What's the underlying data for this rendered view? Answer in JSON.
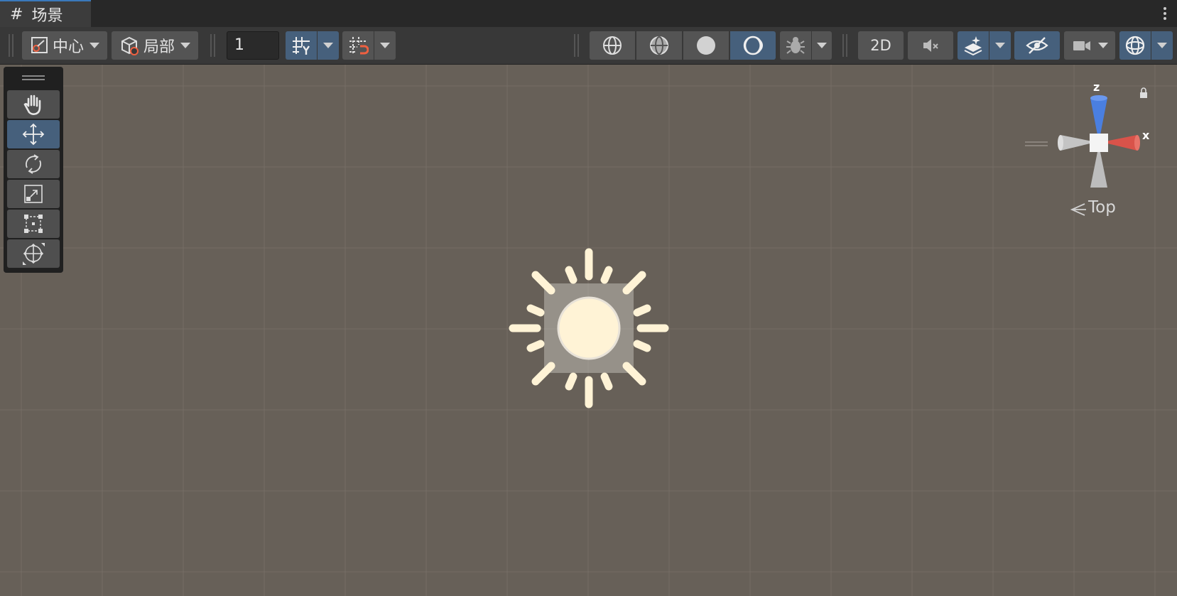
{
  "window": {
    "tab_label": "场景",
    "tab_icon": "scene-hash-icon"
  },
  "toolbar": {
    "pivot_label": "中心",
    "space_label": "局部",
    "grid_increment": "1",
    "toggle_2d_label": "2D"
  },
  "tools": [
    "hand-tool-icon",
    "move-tool-icon",
    "rotate-tool-icon",
    "scale-tool-icon",
    "rect-tool-icon",
    "transform-tool-icon"
  ],
  "gizmo": {
    "view_label": "Top",
    "x_label": "x",
    "z_label": "z",
    "x_color": "#d9534a",
    "z_color": "#4a7fe0"
  },
  "colors": {
    "accent_active": "#46607c",
    "scene_background": "#676058",
    "sun_icon": "#fff3d6"
  }
}
